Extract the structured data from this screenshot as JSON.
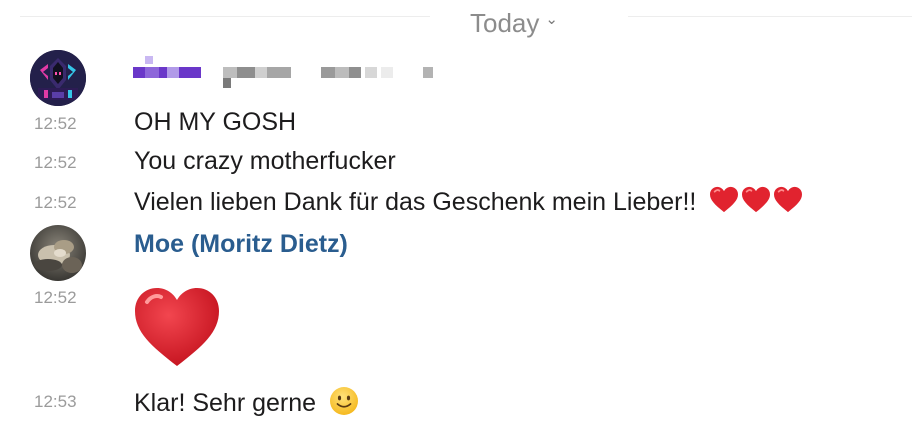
{
  "day_divider": {
    "label": "Today",
    "chevron_icon": "chevron-down-icon"
  },
  "colors": {
    "sender_name": "#2a5d8f",
    "timestamp": "#9b9b9b",
    "redaction_purple": "#6a37c9",
    "heart_red": "#e1232f"
  },
  "groups": [
    {
      "author_avatar_icon": "pixel-art-avatar",
      "author_name_redacted": true,
      "messages": [
        {
          "time": "12:52",
          "text": "OH MY GOSH"
        },
        {
          "time": "12:52",
          "text": "You crazy motherfucker"
        },
        {
          "time": "12:52",
          "text": "Vielen lieben Dank für das Geschenk mein Lieber!!",
          "emoji": [
            "red-heart",
            "red-heart",
            "red-heart"
          ]
        }
      ]
    },
    {
      "author_name": "Moe (Moritz Dietz)",
      "author_avatar_icon": "photo-avatar",
      "messages": [
        {
          "time": "12:52",
          "emoji_only": "red-heart"
        },
        {
          "time": "12:53",
          "text": "Klar! Sehr gerne",
          "emoji": [
            "slightly-smiling-face"
          ]
        }
      ]
    }
  ]
}
